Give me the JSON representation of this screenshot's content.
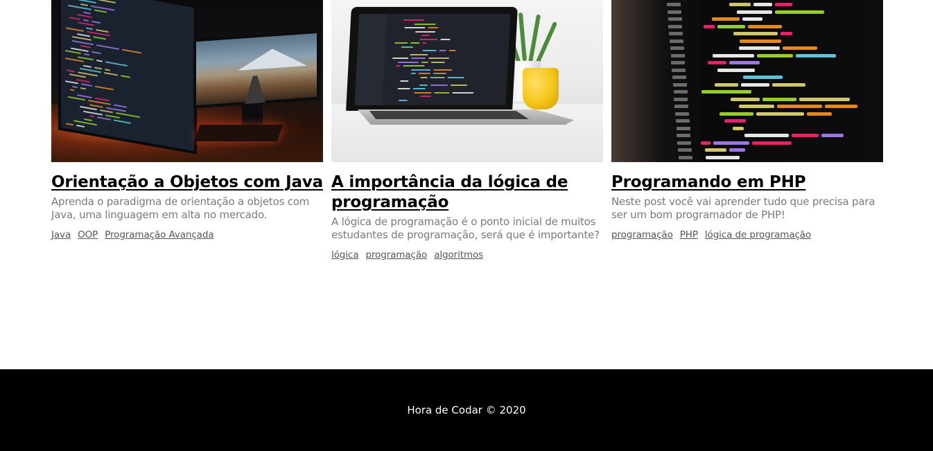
{
  "posts": [
    {
      "title": "Orientação a Objetos com Java",
      "description": "Aprenda o paradigma de orientação a objetos com Java, uma linguagem em alta no mercado.",
      "tags": [
        "Java",
        "OOP",
        "Programação Avançada"
      ]
    },
    {
      "title": "A importância da lógica de programação",
      "description": "A lógica de programação é o ponto inicial de muitos estudantes de programação, será que é importante?",
      "tags": [
        "lógica",
        "programação",
        "algoritmos"
      ]
    },
    {
      "title": "Programando em PHP",
      "description": "Neste post você vai aprender tudo que precisa para ser um bom programador de PHP!",
      "tags": [
        "programação",
        "PHP",
        "lógica de programação"
      ]
    }
  ],
  "footer": {
    "copyright": "Hora de Codar © 2020"
  },
  "colors": {
    "footer_bg": "#000000",
    "title": "#000000",
    "description": "#7a7a7a",
    "tag": "#555555"
  }
}
